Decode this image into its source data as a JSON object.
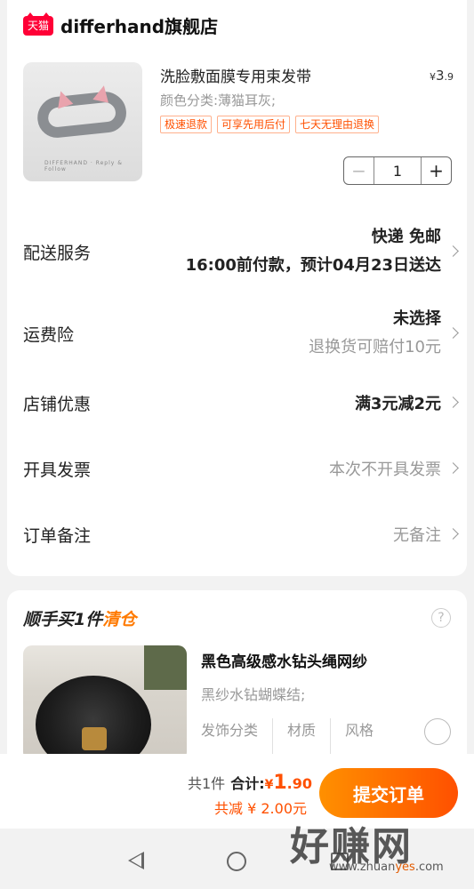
{
  "shop": {
    "badge": "天猫",
    "name": "differhand旗舰店"
  },
  "product": {
    "title": "洗脸敷面膜专用束发带",
    "price_symbol": "¥",
    "price_int": "3",
    "price_dec": ".9",
    "spec": "颜色分类:薄猫耳灰;",
    "tags": [
      "极速退款",
      "可享先用后付",
      "七天无理由退换"
    ],
    "image_caption": "DIFFERHAND · Reply & Follow",
    "quantity": "1",
    "minus": "−",
    "plus": "+"
  },
  "rows": {
    "delivery": {
      "label": "配送服务",
      "line1": "快递 免邮",
      "line2": "16:00前付款，预计04月23日送达"
    },
    "insurance": {
      "label": "运费险",
      "line1": "未选择",
      "line2": "退换货可赔付10元"
    },
    "coupon": {
      "label": "店铺优惠",
      "value": "满3元减2元"
    },
    "invoice": {
      "label": "开具发票",
      "value": "本次不开具发票"
    },
    "note": {
      "label": "订单备注",
      "value": "无备注"
    }
  },
  "addon": {
    "heading_prefix": "顺手买1件",
    "heading_highlight": "清仓",
    "help": "?",
    "title": "黑色高级感水钻头绳网纱",
    "spec": "黑纱水钻蝴蝶结;",
    "attrs": [
      {
        "name": "发饰分类"
      },
      {
        "name": "材质"
      },
      {
        "name": "风格"
      }
    ]
  },
  "bottom": {
    "count_text": "共1件",
    "total_label": "合计:",
    "total_symbol": "¥",
    "total_int": "1",
    "total_dec": ".90",
    "discount": "共减 ¥ 2.00元",
    "submit": "提交订单"
  },
  "watermark": {
    "main": "好赚网",
    "url_prefix": "www.zhuan",
    "url_highlight": "yes",
    "url_suffix": ".com"
  },
  "icons": {
    "back": "back-triangle-icon",
    "home": "home-circle-icon",
    "recent": "recent-square-icon",
    "chevron": "chevron-right-icon",
    "help": "question-circle-icon"
  },
  "colors": {
    "accent": "#ff5000",
    "tmall_red": "#ff0036",
    "submit_gradient_start": "#ff9000",
    "submit_gradient_end": "#ff5000",
    "muted_text": "#999999"
  }
}
